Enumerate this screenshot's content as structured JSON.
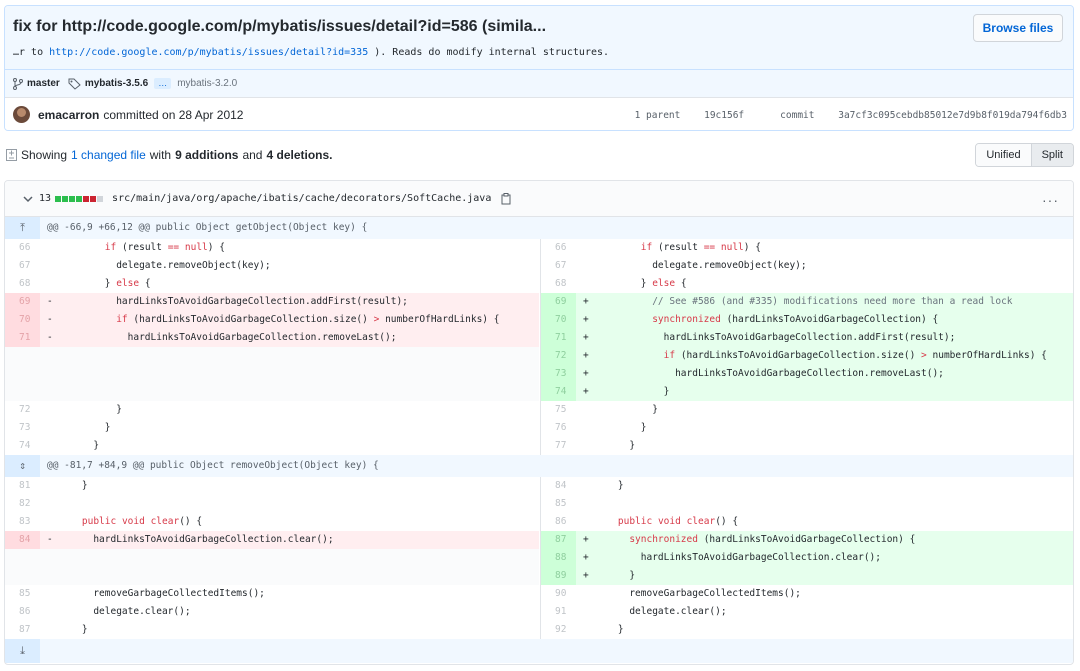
{
  "commit": {
    "title": "fix for http://code.google.com/p/mybatis/issues/detail?id=586 (simila...",
    "desc_prefix": "…r to ",
    "desc_link": "http://code.google.com/p/mybatis/issues/detail?id=335",
    "desc_suffix": " ). Reads do modify internal structures.",
    "browse_label": "Browse files",
    "branch": "master",
    "tag_first": "mybatis-3.5.6",
    "tag_ellipsis": "…",
    "tag_last": "mybatis-3.2.0",
    "author": "emacarron",
    "committed_text": "committed on 28 Apr 2012",
    "parent_label": "1 parent",
    "parent_sha": "19c156f",
    "commit_label": "commit",
    "commit_sha": "3a7cf3c095cebdb85012e7d9b8f019da794f6db3"
  },
  "summary": {
    "showing": "Showing",
    "changed_files": "1 changed file",
    "with": "with",
    "additions": "9 additions",
    "and": "and",
    "deletions": "4 deletions.",
    "view_unified": "Unified",
    "view_split": "Split"
  },
  "file": {
    "change_count": "13",
    "diffstat": [
      "add",
      "add",
      "add",
      "add",
      "del",
      "del",
      "neutral"
    ],
    "path": "src/main/java/org/apache/ibatis/cache/decorators/SoftCache.java",
    "more": "···"
  },
  "colors": {
    "add": "#2cbe4e",
    "del": "#cb2431",
    "neutral": "#d1d5da",
    "link": "#0366d6"
  },
  "hunks": [
    {
      "header": "@@ -66,9 +66,12 @@ public Object getObject(Object key) {",
      "expander_icon": "expand-up-icon",
      "rows": [
        {
          "l": {
            "t": "ctx",
            "n": "66",
            "c": [
              [
                "        ",
                ""
              ],
              [
                "if",
                "kw"
              ],
              [
                " (result ",
                ""
              ],
              [
                "==",
                "op"
              ],
              [
                " ",
                ""
              ],
              [
                "null",
                "kw"
              ],
              [
                ") {",
                ""
              ]
            ]
          },
          "r": {
            "t": "ctx",
            "n": "66",
            "c": [
              [
                "        ",
                ""
              ],
              [
                "if",
                "kw"
              ],
              [
                " (result ",
                ""
              ],
              [
                "==",
                "op"
              ],
              [
                " ",
                ""
              ],
              [
                "null",
                "kw"
              ],
              [
                ") {",
                ""
              ]
            ]
          }
        },
        {
          "l": {
            "t": "ctx",
            "n": "67",
            "c": [
              [
                "          delegate.removeObject(key);",
                ""
              ]
            ]
          },
          "r": {
            "t": "ctx",
            "n": "67",
            "c": [
              [
                "          delegate.removeObject(key);",
                ""
              ]
            ]
          }
        },
        {
          "l": {
            "t": "ctx",
            "n": "68",
            "c": [
              [
                "        } ",
                ""
              ],
              [
                "else",
                "kw"
              ],
              [
                " {",
                ""
              ]
            ]
          },
          "r": {
            "t": "ctx",
            "n": "68",
            "c": [
              [
                "        } ",
                ""
              ],
              [
                "else",
                "kw"
              ],
              [
                " {",
                ""
              ]
            ]
          }
        },
        {
          "l": {
            "t": "del",
            "n": "69",
            "s": "-",
            "c": [
              [
                "          hardLinksToAvoidGarbageCollection.addFirst(result);",
                ""
              ]
            ]
          },
          "r": {
            "t": "add",
            "n": "69",
            "s": "+",
            "c": [
              [
                "          ",
                ""
              ],
              [
                "// See #586 (and #335) modifications need more than a read lock",
                "cm"
              ]
            ]
          }
        },
        {
          "l": {
            "t": "del",
            "n": "70",
            "s": "-",
            "c": [
              [
                "          ",
                ""
              ],
              [
                "if",
                "kw"
              ],
              [
                " (hardLinksToAvoidGarbageCollection.size() ",
                ""
              ],
              [
                ">",
                "op"
              ],
              [
                " numberOfHardLinks) {",
                ""
              ]
            ]
          },
          "r": {
            "t": "add",
            "n": "70",
            "s": "+",
            "c": [
              [
                "          ",
                ""
              ],
              [
                "synchronized",
                "kw"
              ],
              [
                " (hardLinksToAvoidGarbageCollection) {",
                ""
              ]
            ]
          }
        },
        {
          "l": {
            "t": "del",
            "n": "71",
            "s": "-",
            "c": [
              [
                "            hardLinksToAvoidGarbageCollection.removeLast();",
                ""
              ]
            ]
          },
          "r": {
            "t": "add",
            "n": "71",
            "s": "+",
            "c": [
              [
                "            hardLinksToAvoidGarbageCollection.addFirst(result);",
                ""
              ]
            ]
          }
        },
        {
          "l": {
            "t": "empty"
          },
          "r": {
            "t": "add",
            "n": "72",
            "s": "+",
            "c": [
              [
                "            ",
                ""
              ],
              [
                "if",
                "kw"
              ],
              [
                " (hardLinksToAvoidGarbageCollection.size() ",
                ""
              ],
              [
                ">",
                "op"
              ],
              [
                " numberOfHardLinks) {",
                ""
              ]
            ]
          }
        },
        {
          "l": {
            "t": "empty"
          },
          "r": {
            "t": "add",
            "n": "73",
            "s": "+",
            "c": [
              [
                "              hardLinksToAvoidGarbageCollection.removeLast();",
                ""
              ]
            ]
          }
        },
        {
          "l": {
            "t": "empty"
          },
          "r": {
            "t": "add",
            "n": "74",
            "s": "+",
            "c": [
              [
                "            }",
                ""
              ]
            ]
          }
        },
        {
          "l": {
            "t": "ctx",
            "n": "72",
            "c": [
              [
                "          }",
                ""
              ]
            ]
          },
          "r": {
            "t": "ctx",
            "n": "75",
            "c": [
              [
                "          }",
                ""
              ]
            ]
          }
        },
        {
          "l": {
            "t": "ctx",
            "n": "73",
            "c": [
              [
                "        }",
                ""
              ]
            ]
          },
          "r": {
            "t": "ctx",
            "n": "76",
            "c": [
              [
                "        }",
                ""
              ]
            ]
          }
        },
        {
          "l": {
            "t": "ctx",
            "n": "74",
            "c": [
              [
                "      }",
                ""
              ]
            ]
          },
          "r": {
            "t": "ctx",
            "n": "77",
            "c": [
              [
                "      }",
                ""
              ]
            ]
          }
        }
      ]
    },
    {
      "header": "@@ -81,7 +84,9 @@ public Object removeObject(Object key) {",
      "expander_icon": "expand-both-icon",
      "rows": [
        {
          "l": {
            "t": "ctx",
            "n": "81",
            "c": [
              [
                "    }",
                ""
              ]
            ]
          },
          "r": {
            "t": "ctx",
            "n": "84",
            "c": [
              [
                "    }",
                ""
              ]
            ]
          }
        },
        {
          "l": {
            "t": "ctx",
            "n": "82",
            "c": [
              [
                "",
                ""
              ]
            ]
          },
          "r": {
            "t": "ctx",
            "n": "85",
            "c": [
              [
                "",
                ""
              ]
            ]
          }
        },
        {
          "l": {
            "t": "ctx",
            "n": "83",
            "c": [
              [
                "    ",
                ""
              ],
              [
                "public",
                "kw"
              ],
              [
                " ",
                ""
              ],
              [
                "void",
                "kw"
              ],
              [
                " ",
                ""
              ],
              [
                "clear",
                "kw"
              ],
              [
                "() {",
                ""
              ]
            ]
          },
          "r": {
            "t": "ctx",
            "n": "86",
            "c": [
              [
                "    ",
                ""
              ],
              [
                "public",
                "kw"
              ],
              [
                " ",
                ""
              ],
              [
                "void",
                "kw"
              ],
              [
                " ",
                ""
              ],
              [
                "clear",
                "kw"
              ],
              [
                "() {",
                ""
              ]
            ]
          }
        },
        {
          "l": {
            "t": "del",
            "n": "84",
            "s": "-",
            "c": [
              [
                "      hardLinksToAvoidGarbageCollection.clear();",
                ""
              ]
            ]
          },
          "r": {
            "t": "add",
            "n": "87",
            "s": "+",
            "c": [
              [
                "      ",
                ""
              ],
              [
                "synchronized",
                "kw"
              ],
              [
                " (hardLinksToAvoidGarbageCollection) {",
                ""
              ]
            ]
          }
        },
        {
          "l": {
            "t": "empty"
          },
          "r": {
            "t": "add",
            "n": "88",
            "s": "+",
            "c": [
              [
                "        hardLinksToAvoidGarbageCollection.clear();",
                ""
              ]
            ]
          }
        },
        {
          "l": {
            "t": "empty"
          },
          "r": {
            "t": "add",
            "n": "89",
            "s": "+",
            "c": [
              [
                "      }",
                ""
              ]
            ]
          }
        },
        {
          "l": {
            "t": "ctx",
            "n": "85",
            "c": [
              [
                "      removeGarbageCollectedItems();",
                ""
              ]
            ]
          },
          "r": {
            "t": "ctx",
            "n": "90",
            "c": [
              [
                "      removeGarbageCollectedItems();",
                ""
              ]
            ]
          }
        },
        {
          "l": {
            "t": "ctx",
            "n": "86",
            "c": [
              [
                "      delegate.clear();",
                ""
              ]
            ]
          },
          "r": {
            "t": "ctx",
            "n": "91",
            "c": [
              [
                "      delegate.clear();",
                ""
              ]
            ]
          }
        },
        {
          "l": {
            "t": "ctx",
            "n": "87",
            "c": [
              [
                "    }",
                ""
              ]
            ]
          },
          "r": {
            "t": "ctx",
            "n": "92",
            "c": [
              [
                "    }",
                ""
              ]
            ]
          }
        }
      ]
    }
  ],
  "bottom_expander_icon": "expand-down-icon"
}
